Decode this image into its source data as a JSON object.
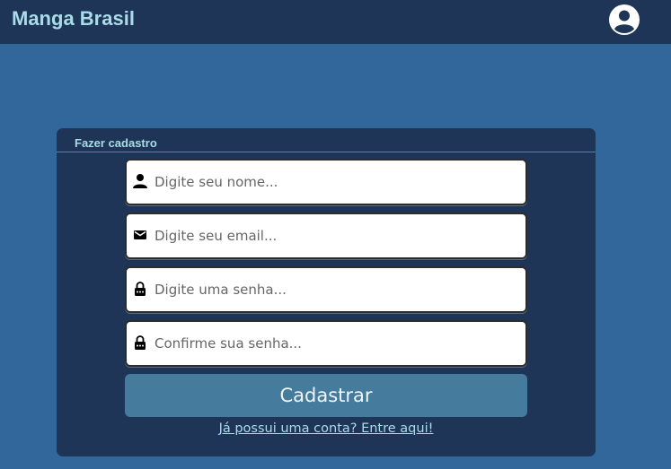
{
  "app": {
    "title": "Manga Brasil",
    "account_icon": "user-circle-icon"
  },
  "colors": {
    "page_background": "#31679b",
    "navbar_background": "#1e3557",
    "panel_background": "#1e3557",
    "accent_text": "#a9dbe8",
    "button_background": "#457b9d"
  },
  "form": {
    "title": "Fazer cadastro",
    "fields": [
      {
        "icon": "person-icon",
        "placeholder": "Digite seu nome...",
        "value": ""
      },
      {
        "icon": "envelope-icon",
        "placeholder": "Digite seu email...",
        "value": ""
      },
      {
        "icon": "lock-icon",
        "placeholder": "Digite uma senha...",
        "value": ""
      },
      {
        "icon": "lock-icon",
        "placeholder": "Confirme sua senha...",
        "value": ""
      }
    ],
    "submit_label": "Cadastrar",
    "login_link": "Já possui uma conta? Entre aqui!"
  }
}
